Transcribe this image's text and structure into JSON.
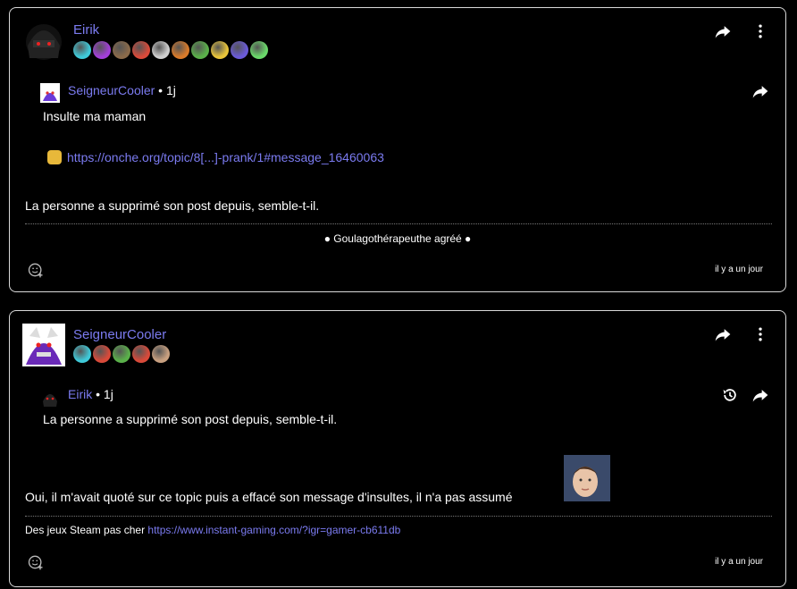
{
  "post1": {
    "author": "Eirik",
    "badges": [
      "#3fc9d8",
      "#a23fd8",
      "#8a6a4a",
      "#d84a3a",
      "#cfcfcf",
      "#d87a2a",
      "#5ab04a",
      "#e8c43a",
      "#6a5ad8",
      "#6ad86a"
    ],
    "quote": {
      "author": "SeigneurCooler",
      "time": " • 1j",
      "text": "Insulte ma maman",
      "link": "https://onche.org/topic/8[...]-prank/1#message_16460063"
    },
    "body": "La personne a supprimé son post depuis, semble-t-il.",
    "signature": "● Goulagothérapeuthe agréé ●",
    "timestamp": "il y a un jour"
  },
  "post2": {
    "author": "SeigneurCooler",
    "badges": [
      "#3fc9d8",
      "#d84a3a",
      "#5ab04a",
      "#d84a3a",
      "#c8a080"
    ],
    "quote": {
      "author": "Eirik",
      "time": " • 1j",
      "text": "La personne a supprimé son post depuis, semble-t-il."
    },
    "body": "Oui, il m'avait quoté sur ce topic puis a effacé son message d'insultes, il n'a pas assumé",
    "signature_text": "Des jeux Steam pas cher ",
    "signature_link": "https://www.instant-gaming.com/?igr=gamer-cb611db",
    "timestamp": "il y a un jour"
  },
  "icons": [
    "share-icon",
    "more-vert-icon",
    "history-icon",
    "add-reaction-icon"
  ]
}
